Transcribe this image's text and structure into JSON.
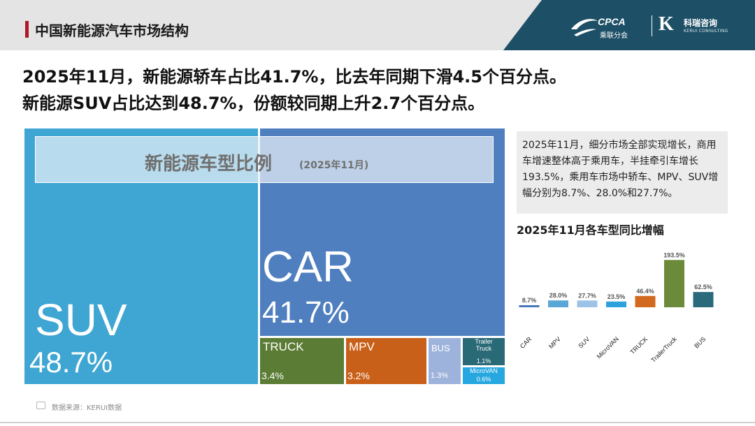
{
  "header": {
    "title": "中国新能源汽车市场结构",
    "cpca_logo": "CPCA",
    "cpca_sub": "乘联分会",
    "kerui_name": "科瑞咨询",
    "kerui_en": "KERUI CONSULTING"
  },
  "headline": {
    "line1": "2025年11月，新能源轿车占比41.7%，比去年同期下滑4.5个百分点。",
    "line2": "新能源SUV占比达到48.7%，份额较同期上升2.7个百分点。"
  },
  "treemap": {
    "title": "新能源车型比例",
    "period": "(2025年11月)",
    "tiles": [
      {
        "label": "SUV",
        "value": "48.7%",
        "color": "#3fa6d3"
      },
      {
        "label": "CAR",
        "value": "41.7%",
        "color": "#4f7fbf"
      },
      {
        "label": "TRUCK",
        "value": "3.4%",
        "color": "#5b7c35"
      },
      {
        "label": "MPV",
        "value": "3.2%",
        "color": "#c9601a"
      },
      {
        "label": "BUS",
        "value": "1.3%",
        "color": "#9db3dc"
      },
      {
        "label": "Trailer\nTruck",
        "value": "1.1%",
        "color": "#2a6a77"
      },
      {
        "label": "MicroVAN",
        "value": "0.6%",
        "color": "#27a7df"
      }
    ]
  },
  "note": {
    "text": "2025年11月，细分市场全部实现增长，商用车增速整体高于乘用车，半挂牵引车增长193.5%，乘用车市场中轿车、MPV、SUV增幅分别为8.7%、28.0%和27.7%。"
  },
  "chart_data": {
    "type": "bar",
    "title": "2025年11月各车型同比增幅",
    "categories": [
      "CAR",
      "MPV",
      "SUV",
      "MicroVAN",
      "TRUCK",
      "TrailerTruck",
      "BUS"
    ],
    "values": [
      8.7,
      28.0,
      27.7,
      23.5,
      46.4,
      193.5,
      62.5
    ],
    "value_labels": [
      "8.7%",
      "28.0%",
      "27.7%",
      "23.5%",
      "46.4%",
      "193.5%",
      "62.5%"
    ],
    "colors": [
      "#4a78b8",
      "#5aa6d6",
      "#9cc2e5",
      "#2ea1dc",
      "#d16a1e",
      "#6b8a3a",
      "#2b6a7a"
    ],
    "ylim": [
      0,
      200
    ],
    "xlabel": "",
    "ylabel": ""
  },
  "footer": {
    "source": "数据来源：KERUI数据"
  }
}
